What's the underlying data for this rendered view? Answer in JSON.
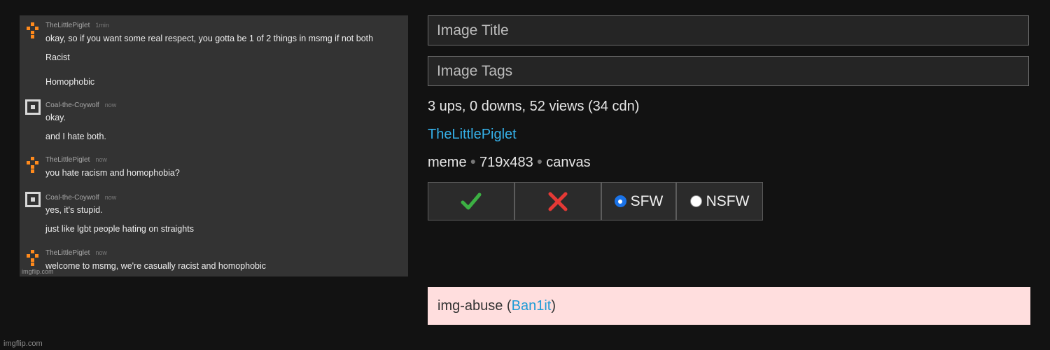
{
  "chat": {
    "groups": [
      {
        "user": "TheLittlePiglet",
        "time": "1min",
        "avatar": "piglet-icon",
        "lines": [
          "okay, so if you want some real respect, you gotta be 1 of 2 things in msmg if not both",
          "Racist",
          "Homophobic"
        ]
      },
      {
        "user": "Coal-the-Coywolf",
        "time": "now",
        "avatar": "coal-square-icon",
        "lines": [
          "okay.",
          "and I hate both."
        ]
      },
      {
        "user": "TheLittlePiglet",
        "time": "now",
        "avatar": "piglet-icon",
        "lines": [
          "you hate racism and homophobia?"
        ]
      },
      {
        "user": "Coal-the-Coywolf",
        "time": "now",
        "avatar": "coal-square-icon",
        "lines": [
          "yes, it's stupid.",
          "just like lgbt people hating on straights"
        ]
      },
      {
        "user": "TheLittlePiglet",
        "time": "now",
        "avatar": "piglet-icon",
        "lines": [
          "welcome to msmg, we're casually racist and homophobic"
        ]
      }
    ],
    "watermark": "imgflip.com"
  },
  "form": {
    "title_placeholder": "Image Title",
    "tags_placeholder": "Image Tags"
  },
  "stats": "3 ups, 0 downs, 52 views (34 cdn)",
  "author": "TheLittlePiglet",
  "meta": {
    "stream": "meme",
    "dimensions": "719x483",
    "source": "canvas"
  },
  "moderation": {
    "approve_icon": "checkmark-icon",
    "reject_icon": "x-icon",
    "sfw_label": "SFW",
    "nsfw_label": "NSFW",
    "selected": "SFW",
    "approve_color": "#3cb043",
    "reject_color": "#e53935"
  },
  "abuse": {
    "prefix": "img-abuse (",
    "user": "Ban1it",
    "suffix": ")",
    "background": "#ffdede"
  },
  "footer_watermark": "imgflip.com"
}
